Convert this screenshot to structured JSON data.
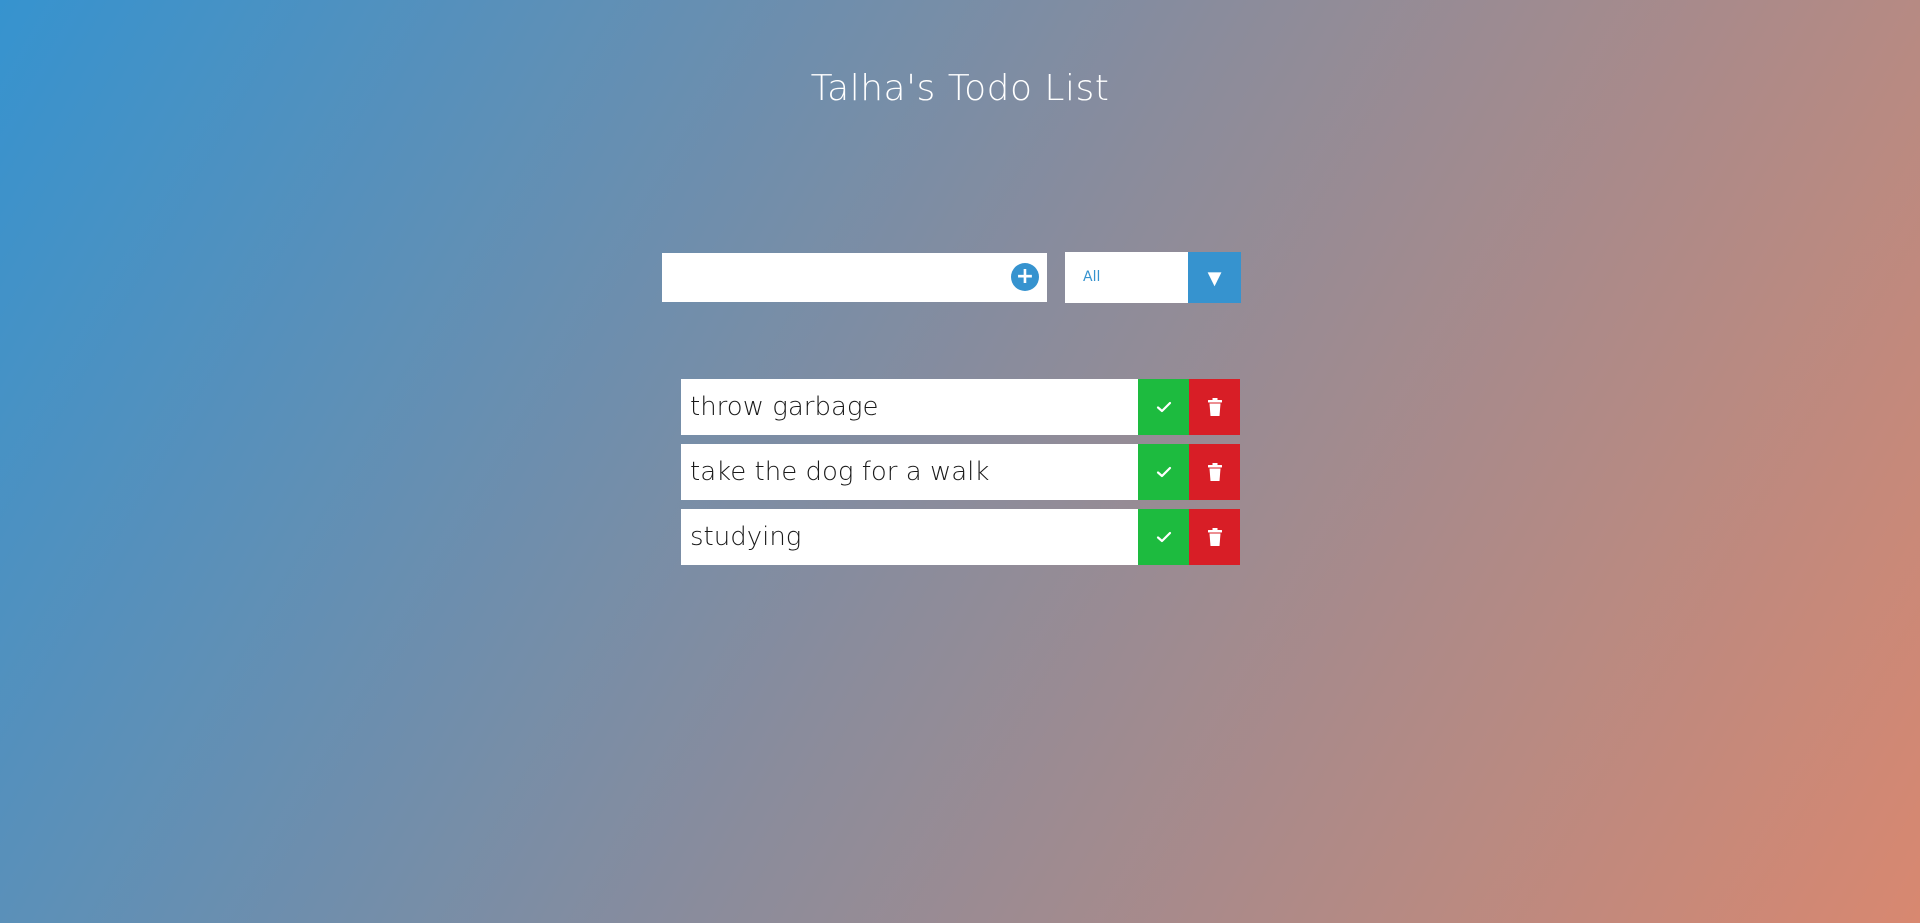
{
  "title": "Talha's Todo List",
  "input": {
    "value": "",
    "placeholder": "",
    "add_icon": "plus-circle-icon"
  },
  "filter": {
    "selected": "All",
    "arrow_glyph": "▼"
  },
  "todos": [
    {
      "text": "throw garbage"
    },
    {
      "text": "take the dog for a walk"
    },
    {
      "text": "studying"
    }
  ],
  "colors": {
    "accent": "#3693cf",
    "complete": "#1dbb3f",
    "delete": "#d81e26",
    "gradient_start": "#3693cf",
    "gradient_end": "#d88870"
  }
}
